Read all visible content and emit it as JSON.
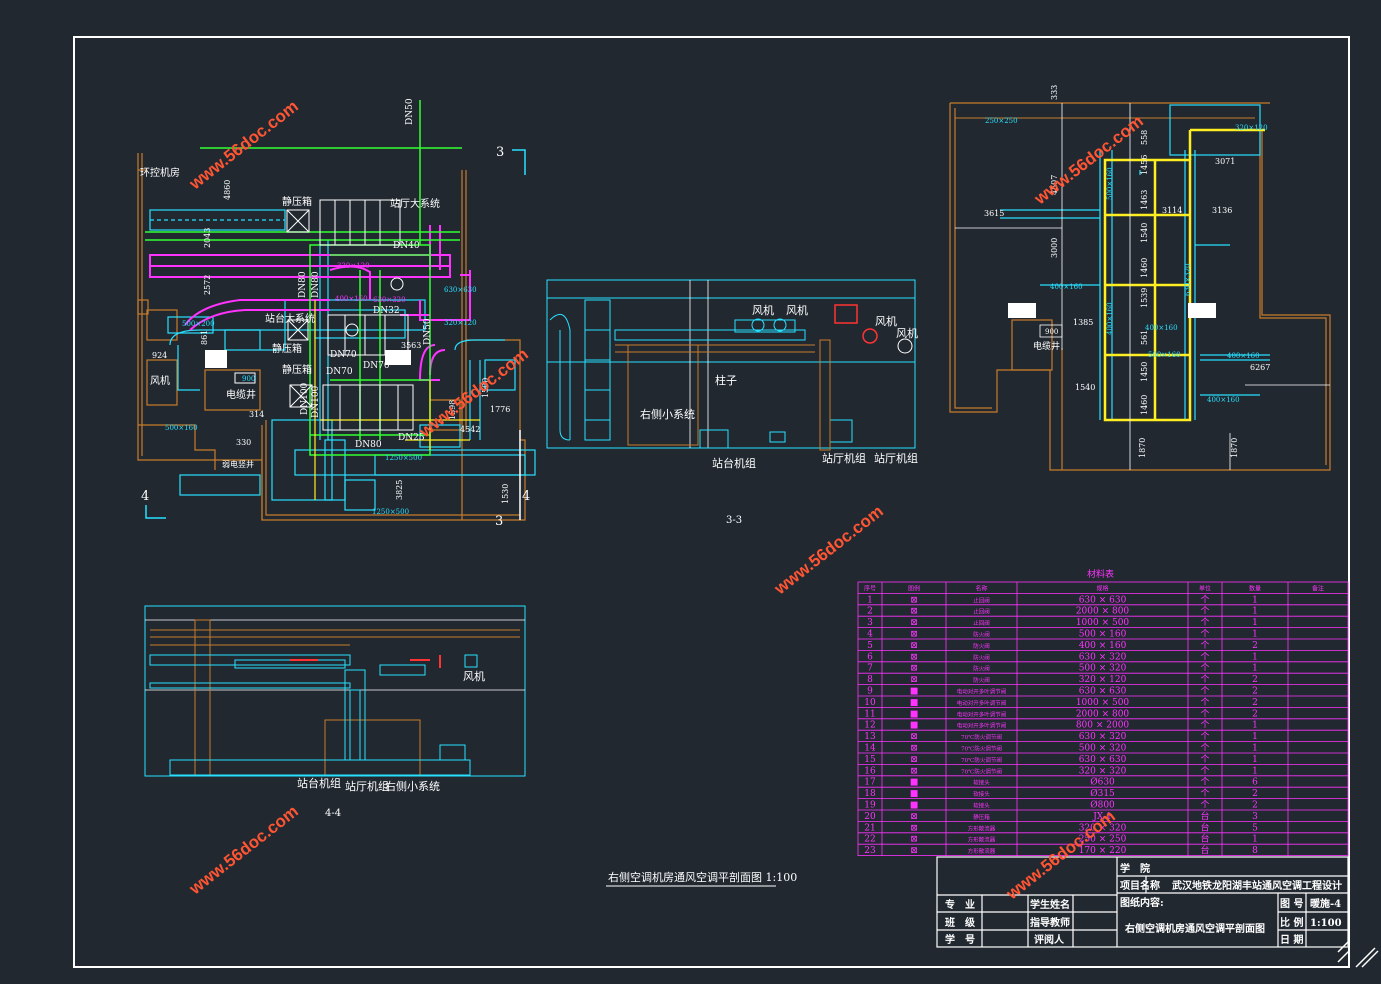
{
  "watermark": "www.56doc.com",
  "colors": {
    "background": "#212830",
    "border": "#ffffff",
    "cyan": "#28e0ff",
    "magenta": "#ff33ff",
    "green": "#33ff33",
    "yellow": "#ffee22",
    "orange": "#c87b2a",
    "white": "#ffffff",
    "red": "#ff3333",
    "watermark": "#ff5533"
  },
  "plan_left": {
    "rooms": {
      "elevator": "环控机房",
      "static_box_1": "静压箱",
      "station_hall_sys": "站厅大系统",
      "platform_sys": "站台大系统",
      "static_box_2": "静压箱",
      "static_box_3": "静压箱",
      "fan": "风机",
      "shaft": "电缆井",
      "cable": "弱电竖井"
    },
    "pipes": [
      "DN50",
      "DN40",
      "DN80",
      "DN80",
      "DN32",
      "DN50",
      "DN70",
      "DN70",
      "DN100",
      "DN100",
      "DN80",
      "DN25"
    ],
    "dims": [
      "4860",
      "2043",
      "2572",
      "924",
      "861",
      "3563",
      "314",
      "330",
      "1776",
      "4542",
      "1500",
      "1530",
      "3825",
      "1598"
    ],
    "ducts": [
      "1250×500",
      "1250×500",
      "320×120",
      "400×160",
      "630×320",
      "500×200",
      "320×120",
      "630×630",
      "400×160",
      "900",
      "1000×500",
      "500×160"
    ],
    "section_marks": [
      "3",
      "3",
      "4",
      "4"
    ]
  },
  "section33": {
    "labels": {
      "fan1": "风机",
      "fan2": "风机",
      "fan3": "风机",
      "fan4": "风机",
      "column": "柱子",
      "right_small": "右侧小系统",
      "platform_unit": "站台机组",
      "hall_unit1": "站厅机组",
      "hall_unit2": "站厅机组"
    },
    "title": "3-3"
  },
  "section44": {
    "labels": {
      "fan": "风机",
      "platform_unit": "站台机组",
      "hall_unit": "站厅机组",
      "right_small": "右侧小系统"
    },
    "title": "4-4"
  },
  "plan_right": {
    "dims": [
      "333",
      "4507",
      "3615",
      "3000",
      "1385",
      "1540",
      "3071",
      "3114",
      "3136",
      "6267",
      "1870",
      "1870",
      "1456",
      "1463",
      "1540",
      "1460",
      "1539",
      "1450",
      "1460",
      "561",
      "558",
      "900"
    ],
    "ducts": [
      "250×250",
      "320×120",
      "500×160",
      "400×160",
      "400×160",
      "400×160",
      "400×160",
      "400×160",
      "500×160",
      "630×320"
    ],
    "labels": {
      "shaft": "电缆井"
    }
  },
  "drawing_title": "右侧空调机房通风空调平剖面图 1:100",
  "material_table": {
    "title": "材料表",
    "headers": [
      "序号",
      "图例",
      "名称",
      "规格",
      "单位",
      "数量",
      "备注"
    ],
    "rows": [
      [
        "1",
        "⊠",
        "止回阀",
        "630 × 630",
        "个",
        "1",
        ""
      ],
      [
        "2",
        "⊠",
        "止回阀",
        "2000 × 800",
        "个",
        "1",
        ""
      ],
      [
        "3",
        "⊠",
        "止回阀",
        "1000 × 500",
        "个",
        "1",
        ""
      ],
      [
        "4",
        "⊠",
        "防火阀",
        "500 × 160",
        "个",
        "1",
        ""
      ],
      [
        "5",
        "⊠",
        "防火阀",
        "400 × 160",
        "个",
        "2",
        ""
      ],
      [
        "6",
        "⊠",
        "防火阀",
        "630 × 320",
        "个",
        "1",
        ""
      ],
      [
        "7",
        "⊠",
        "防火阀",
        "500 × 320",
        "个",
        "1",
        ""
      ],
      [
        "8",
        "⊠",
        "防火阀",
        "320 × 120",
        "个",
        "2",
        ""
      ],
      [
        "9",
        "■",
        "电动对开多叶调节阀",
        "630 × 630",
        "个",
        "2",
        ""
      ],
      [
        "10",
        "■",
        "电动对开多叶调节阀",
        "1000 × 500",
        "个",
        "2",
        ""
      ],
      [
        "11",
        "■",
        "电动对开多叶调节阀",
        "2000 × 800",
        "个",
        "2",
        ""
      ],
      [
        "12",
        "■",
        "电动对开多叶调节阀",
        "800 × 2000",
        "个",
        "1",
        ""
      ],
      [
        "13",
        "⊠",
        "70℃防火调节阀",
        "630 × 320",
        "个",
        "1",
        ""
      ],
      [
        "14",
        "⊠",
        "70℃防火调节阀",
        "500 × 320",
        "个",
        "1",
        ""
      ],
      [
        "15",
        "⊠",
        "70℃防火调节阀",
        "630 × 630",
        "个",
        "1",
        ""
      ],
      [
        "16",
        "⊠",
        "70℃防火调节阀",
        "320 × 320",
        "个",
        "1",
        ""
      ],
      [
        "17",
        "■",
        "软接头",
        "Ø630",
        "个",
        "6",
        ""
      ],
      [
        "18",
        "■",
        "软接头",
        "Ø315",
        "个",
        "2",
        ""
      ],
      [
        "19",
        "■",
        "软接头",
        "Ø800",
        "个",
        "2",
        ""
      ],
      [
        "20",
        "⊠",
        "静压箱",
        "JX-1",
        "台",
        "3",
        ""
      ],
      [
        "21",
        "⊠",
        "方形散流器",
        "320 × 320",
        "台",
        "5",
        ""
      ],
      [
        "22",
        "⊠",
        "方形散流器",
        "250 × 250",
        "台",
        "1",
        ""
      ],
      [
        "23",
        "⊠",
        "方形散流器",
        "170 × 220",
        "台",
        "8",
        ""
      ]
    ]
  },
  "title_block": {
    "school_label": "学　院",
    "project_label": "项目名称",
    "project_value": "武汉地铁龙阳湖丰站通风空调工程设计",
    "content_label": "图纸内容:",
    "content_value": "右侧空调机房通风空调平剖面图",
    "major_label": "专　业",
    "class_label": "班　级",
    "id_label": "学　号",
    "student_label": "学生姓名",
    "advisor_label": "指导教师",
    "reviewer_label": "评阅人",
    "drawing_no_label": "图 号",
    "drawing_no_value": "暖施-4",
    "scale_label": "比 例",
    "scale_value": "1:100",
    "date_label": "日 期"
  }
}
